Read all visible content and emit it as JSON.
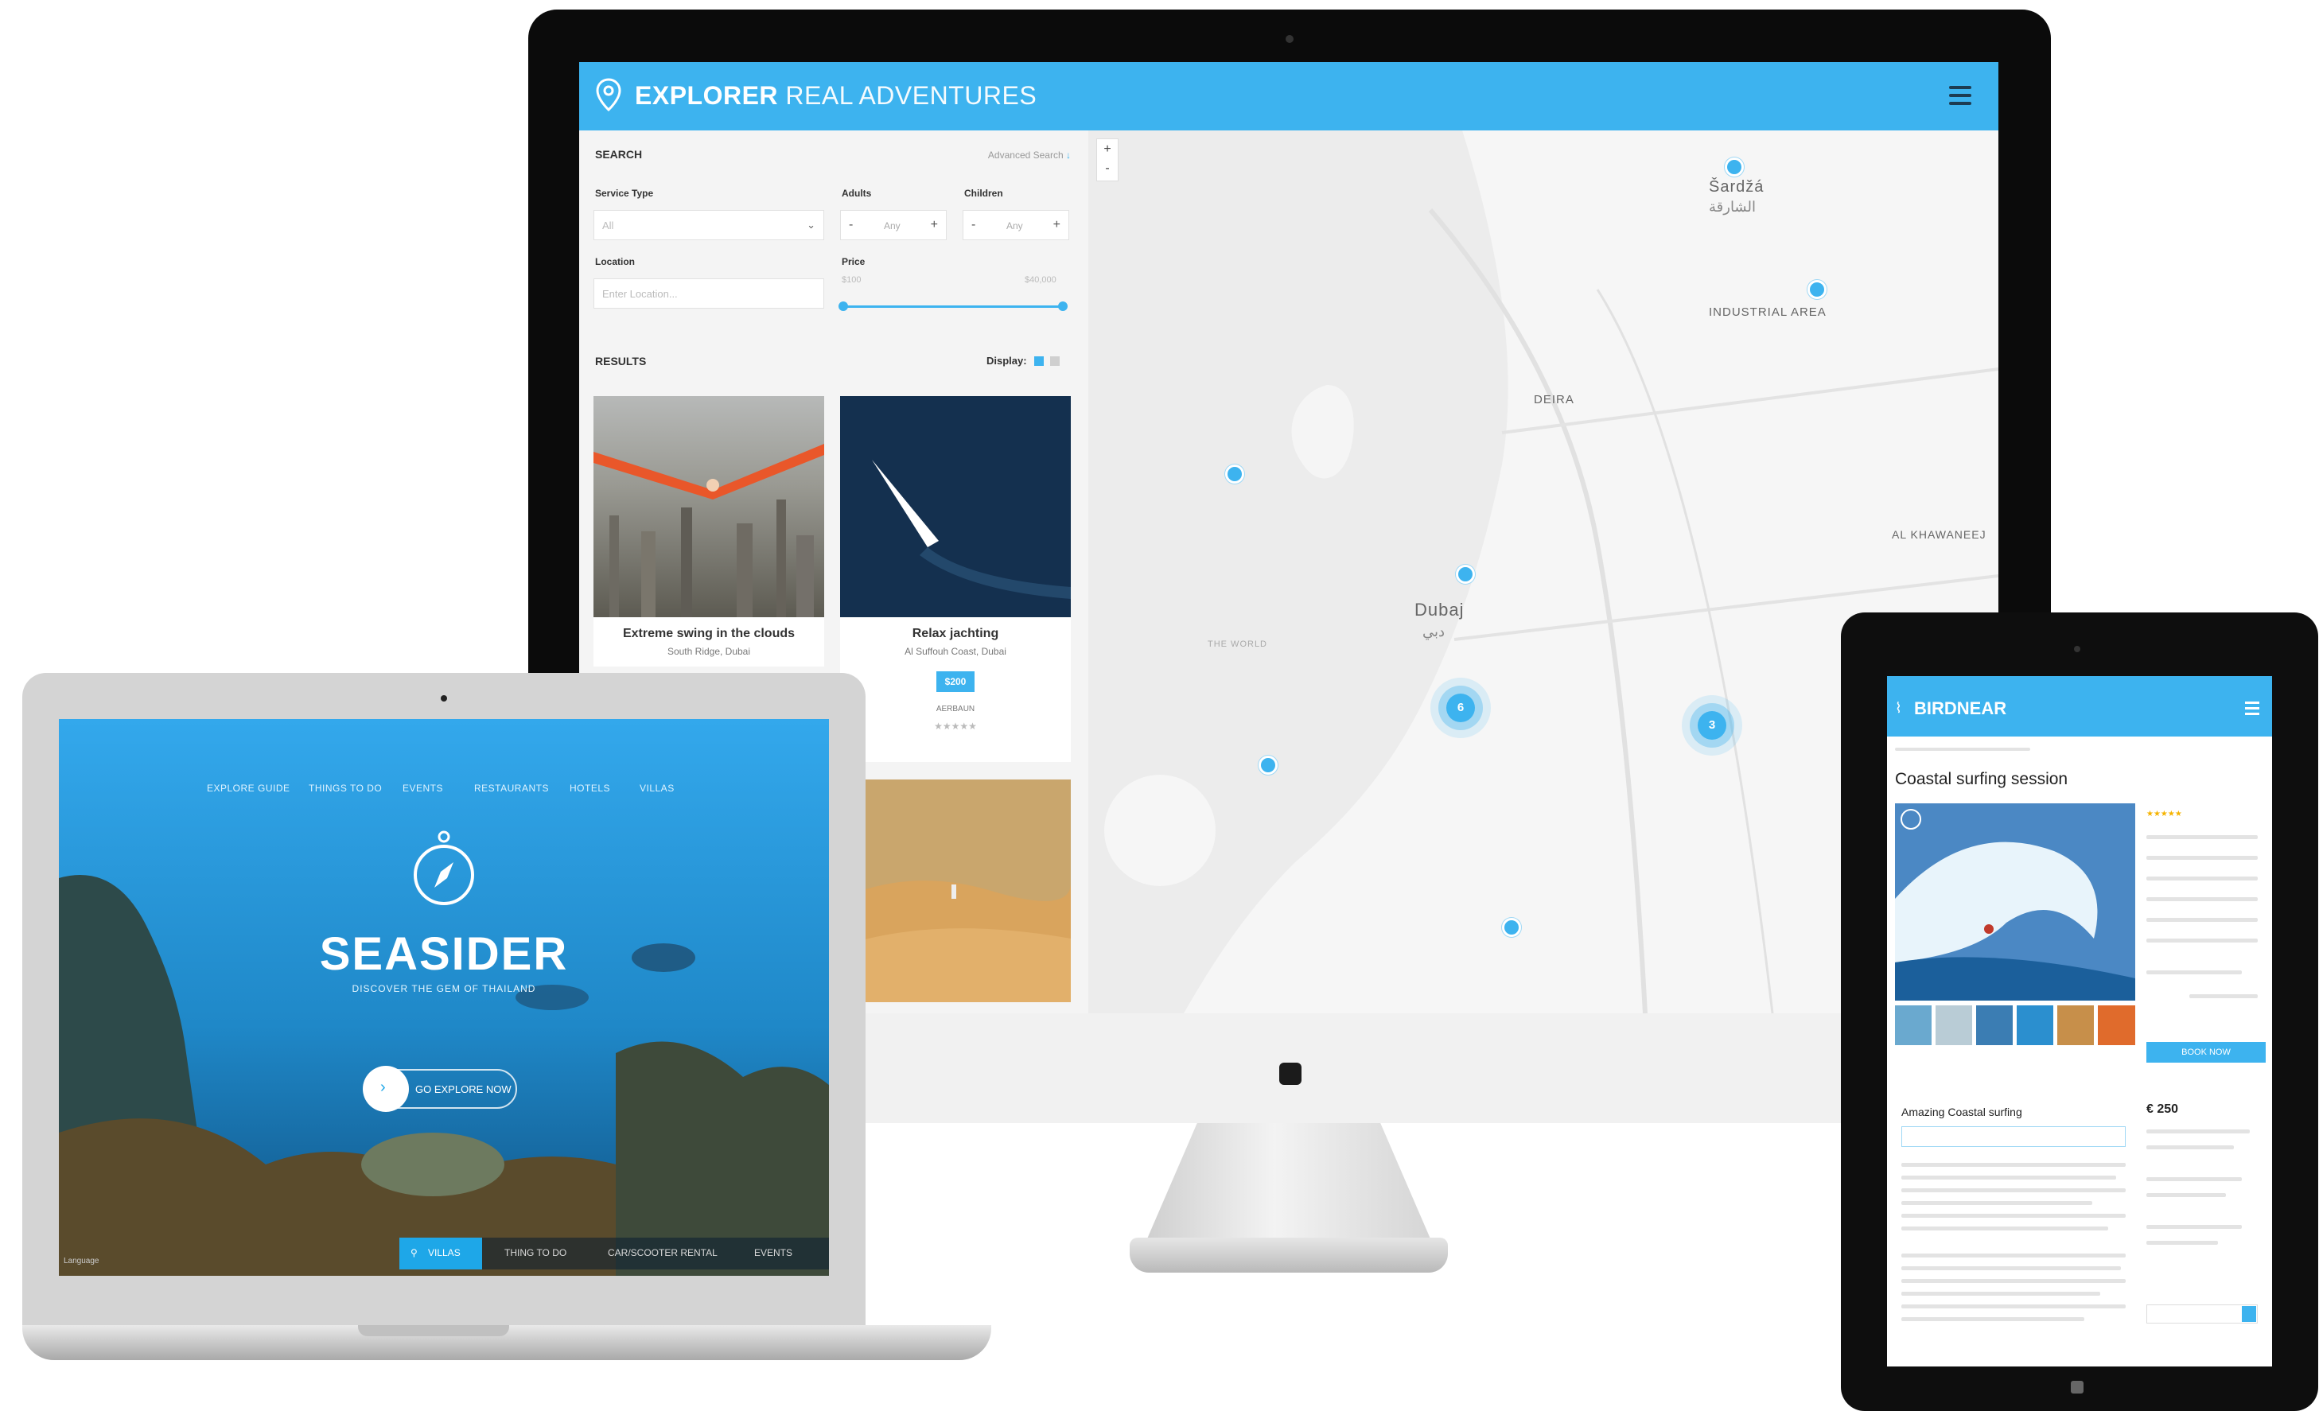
{
  "explorer": {
    "brand_bold": "EXPLORER",
    "brand_light": " REAL ADVENTURES",
    "search_title": "SEARCH",
    "advanced_search": "Advanced Search",
    "service_type_label": "Service Type",
    "service_type_value": "All",
    "adults_label": "Adults",
    "adults_value": "Any",
    "children_label": "Children",
    "children_value": "Any",
    "location_label": "Location",
    "location_placeholder": "Enter Location...",
    "price_label": "Price",
    "price_min": "$100",
    "price_max": "$40,000",
    "results_title": "RESULTS",
    "display_label": "Display:",
    "cards": [
      {
        "title": "Extreme swing in the clouds",
        "subtitle": "South Ridge, Dubai"
      },
      {
        "title": "Relax jachting",
        "subtitle": "Al Suffouh Coast, Dubai",
        "price": "$200",
        "vendor": "AERBAUN"
      }
    ],
    "map_labels": {
      "sharjah": "Šardžá",
      "sharjah_ar": "الشارقة",
      "industrial_area": "INDUSTRIAL AREA",
      "deira": "DEIRA",
      "dubai": "Dubaj",
      "dubai_ar": "دبي",
      "al_khawaneej": "AL KHAWANEEJ",
      "the_world": "THE WORLD"
    },
    "clusters": [
      "6",
      "3"
    ]
  },
  "seasider": {
    "nav": [
      "EXPLORE GUIDE",
      "THINGS TO DO",
      "EVENTS",
      "RESTAURANTS",
      "HOTELS",
      "VILLAS"
    ],
    "title": "SEASIDER",
    "subtitle": "DISCOVER THE GEM OF THAILAND",
    "explore_button": "GO EXPLORE NOW",
    "tabs": [
      "VILLAS",
      "THING TO DO",
      "CAR/SCOOTER RENTAL",
      "EVENTS"
    ],
    "language": "Language"
  },
  "birdnear": {
    "brand": "BIRDNEAR",
    "title": "Coastal surfing session",
    "book_button": "BOOK NOW",
    "section_title": "Amazing Coastal surfing",
    "price": "€ 250"
  },
  "colors": {
    "accent": "#3db3ef",
    "screen_bg": "#f4f4f4",
    "map_bg": "#ececec"
  }
}
